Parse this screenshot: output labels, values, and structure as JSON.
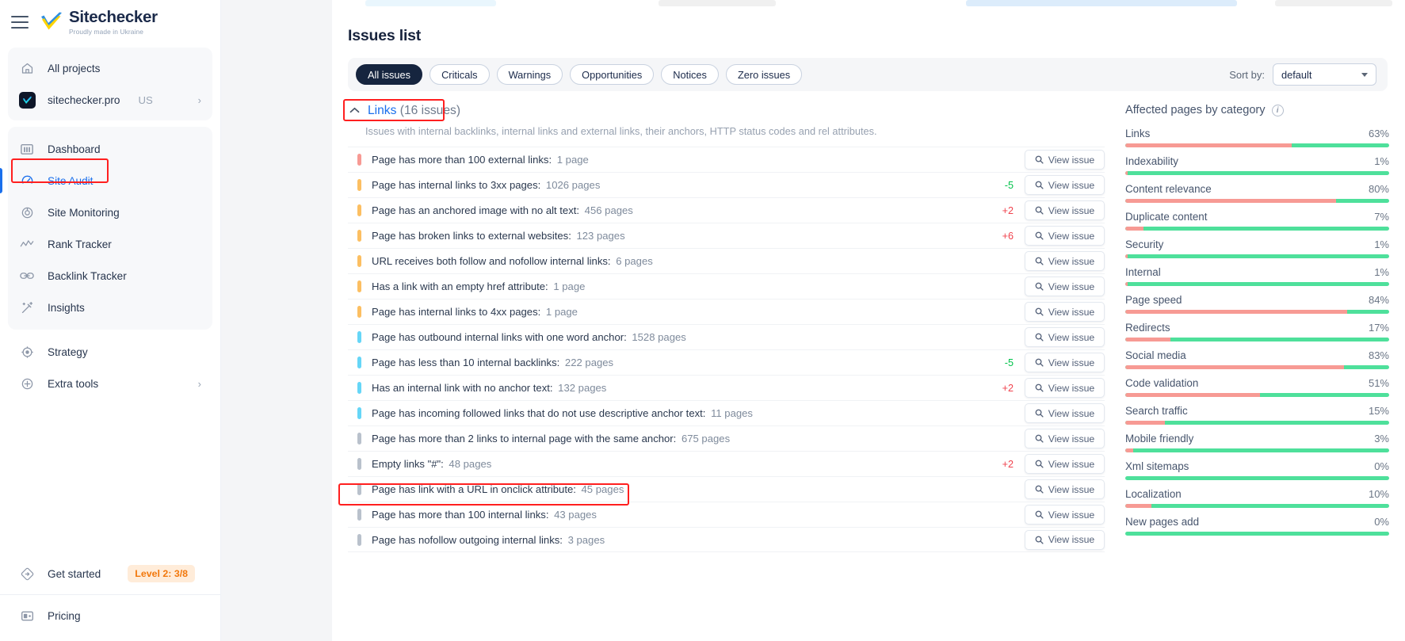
{
  "brand": {
    "name": "Sitechecker",
    "tagline": "Proudly made in Ukraine"
  },
  "sidebar": {
    "projects": [
      {
        "label": "All projects",
        "icon": "home-icon"
      },
      {
        "label": "sitechecker.pro",
        "suffix": "US",
        "icon": "project-avatar-icon",
        "chevron": "›"
      }
    ],
    "nav": [
      {
        "label": "Dashboard",
        "icon": "dashboard-icon",
        "active": false
      },
      {
        "label": "Site Audit",
        "icon": "site-audit-icon",
        "active": true
      },
      {
        "label": "Site Monitoring",
        "icon": "site-monitoring-icon",
        "active": false
      },
      {
        "label": "Rank Tracker",
        "icon": "rank-tracker-icon",
        "active": false
      },
      {
        "label": "Backlink Tracker",
        "icon": "backlink-tracker-icon",
        "active": false
      },
      {
        "label": "Insights",
        "icon": "insights-icon",
        "active": false
      }
    ],
    "tools": [
      {
        "label": "Strategy",
        "icon": "strategy-icon"
      },
      {
        "label": "Extra tools",
        "icon": "extra-tools-icon",
        "chevron": "›"
      }
    ],
    "bottom": {
      "get_started_label": "Get started",
      "level_badge": "Level 2: 3/8",
      "pricing_label": "Pricing"
    }
  },
  "main": {
    "page_title": "Issues list",
    "filters": [
      {
        "label": "All issues",
        "selected": true
      },
      {
        "label": "Criticals",
        "selected": false
      },
      {
        "label": "Warnings",
        "selected": false
      },
      {
        "label": "Opportunities",
        "selected": false
      },
      {
        "label": "Notices",
        "selected": false
      },
      {
        "label": "Zero issues",
        "selected": false
      }
    ],
    "sort": {
      "label": "Sort by:",
      "value": "default"
    },
    "section": {
      "caret": "⌃",
      "title": "Links",
      "count": "(16 issues)",
      "description": "Issues with internal backlinks, internal links and external links, their anchors, HTTP status codes and rel attributes."
    },
    "view_issue_label": "View issue",
    "issues": [
      {
        "severity": "critical",
        "name": "Page has more than 100 external links",
        "pages": "1 page",
        "delta": ""
      },
      {
        "severity": "warning",
        "name": "Page has internal links to 3xx pages",
        "pages": "1026 pages",
        "delta": "-5"
      },
      {
        "severity": "warning",
        "name": "Page has an anchored image with no alt text",
        "pages": "456 pages",
        "delta": "+2"
      },
      {
        "severity": "warning",
        "name": "Page has broken links to external websites",
        "pages": "123 pages",
        "delta": "+6"
      },
      {
        "severity": "warning",
        "name": "URL receives both follow and nofollow internal links",
        "pages": "6 pages",
        "delta": ""
      },
      {
        "severity": "warning",
        "name": "Has a link with an empty href attribute",
        "pages": "1 page",
        "delta": ""
      },
      {
        "severity": "warning",
        "name": "Page has internal links to 4xx pages",
        "pages": "1 page",
        "delta": ""
      },
      {
        "severity": "opportunity",
        "name": "Page has outbound internal links with one word anchor",
        "pages": "1528 pages",
        "delta": ""
      },
      {
        "severity": "opportunity",
        "name": "Page has less than 10 internal backlinks",
        "pages": "222 pages",
        "delta": "-5"
      },
      {
        "severity": "opportunity",
        "name": "Has an internal link with no anchor text",
        "pages": "132 pages",
        "delta": "+2"
      },
      {
        "severity": "opportunity",
        "name": "Page has incoming followed links that do not use descriptive anchor text",
        "pages": "11 pages",
        "delta": ""
      },
      {
        "severity": "notice",
        "name": "Page has more than 2 links to internal page with the same anchor",
        "pages": "675 pages",
        "delta": ""
      },
      {
        "severity": "notice",
        "name": "Empty links \"#\"",
        "pages": "48 pages",
        "delta": "+2"
      },
      {
        "severity": "notice",
        "name": "Page has link with a URL in onclick attribute",
        "pages": "45 pages",
        "delta": "",
        "highlighted": true
      },
      {
        "severity": "notice",
        "name": "Page has more than 100 internal links",
        "pages": "43 pages",
        "delta": ""
      },
      {
        "severity": "notice",
        "name": "Page has nofollow outgoing internal links",
        "pages": "3 pages",
        "delta": ""
      }
    ]
  },
  "side_panel": {
    "title": "Affected pages by category",
    "categories": [
      {
        "name": "Links",
        "pct": "63%",
        "value": 63
      },
      {
        "name": "Indexability",
        "pct": "1%",
        "value": 1
      },
      {
        "name": "Content relevance",
        "pct": "80%",
        "value": 80
      },
      {
        "name": "Duplicate content",
        "pct": "7%",
        "value": 7
      },
      {
        "name": "Security",
        "pct": "1%",
        "value": 1
      },
      {
        "name": "Internal",
        "pct": "1%",
        "value": 1
      },
      {
        "name": "Page speed",
        "pct": "84%",
        "value": 84
      },
      {
        "name": "Redirects",
        "pct": "17%",
        "value": 17
      },
      {
        "name": "Social media",
        "pct": "83%",
        "value": 83
      },
      {
        "name": "Code validation",
        "pct": "51%",
        "value": 51
      },
      {
        "name": "Search traffic",
        "pct": "15%",
        "value": 15
      },
      {
        "name": "Mobile friendly",
        "pct": "3%",
        "value": 3
      },
      {
        "name": "Xml sitemaps",
        "pct": "0%",
        "value": 0
      },
      {
        "name": "Localization",
        "pct": "10%",
        "value": 10
      },
      {
        "name": "New pages add",
        "pct": "0%",
        "value": 0
      }
    ]
  },
  "colors": {
    "accent": "#1a6fec",
    "critical": "#f79a94",
    "warning": "#fcbf62",
    "opportunity": "#66d6f7",
    "notice": "#b9c1cc",
    "delta_up": "#f0434e",
    "delta_down": "#00c24a",
    "bar_green": "#4ee09b",
    "bar_red": "#f79a94",
    "highlight": "#ff1f1f",
    "badge_bg": "#ffecd9",
    "badge_text": "#f2780c"
  }
}
